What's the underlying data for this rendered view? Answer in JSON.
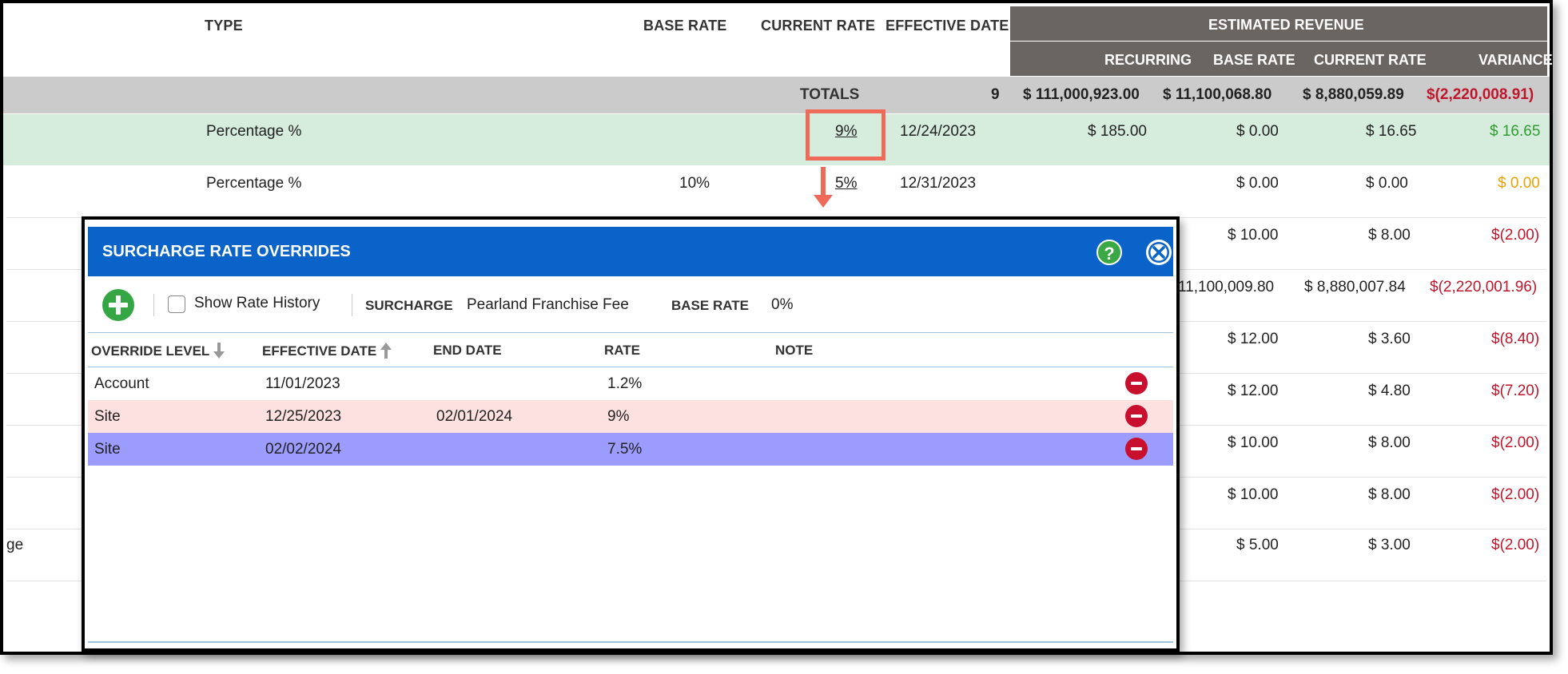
{
  "header": {
    "type": "TYPE",
    "base_rate": "BASE RATE",
    "current_rate": "CURRENT RATE",
    "effective_date": "EFFECTIVE DATE",
    "estimated_revenue": "ESTIMATED REVENUE",
    "recurring": "RECURRING",
    "rev_base_rate": "BASE RATE",
    "rev_current_rate": "CURRENT RATE",
    "variance": "VARIANCE"
  },
  "totals": {
    "label": "TOTALS",
    "count": "9",
    "recurring": "$ 111,000,923.00",
    "base_rate": "$ 11,100,068.80",
    "current_rate": "$ 8,880,059.89",
    "variance": "$(2,220,008.91)"
  },
  "rows": [
    {
      "type": "Percentage %",
      "base_rate": "",
      "current_rate": "9%",
      "effective_date": "12/24/2023",
      "recurring": "$ 185.00",
      "rev_base": "$ 0.00",
      "rev_current": "$ 16.65",
      "variance": "$ 16.65"
    },
    {
      "type": "Percentage %",
      "base_rate": "10%",
      "current_rate": "5%",
      "effective_date": "12/31/2023",
      "recurring": "",
      "rev_base": "$ 0.00",
      "rev_current": "$ 0.00",
      "variance": "$ 0.00"
    },
    {
      "rev_base": "$ 10.00",
      "rev_current": "$ 8.00",
      "variance": "$(2.00)"
    },
    {
      "rev_base": "11,100,009.80",
      "rev_current": "$ 8,880,007.84",
      "variance": "$(2,220,001.96)"
    },
    {
      "rev_base": "$ 12.00",
      "rev_current": "$ 3.60",
      "variance": "$(8.40)"
    },
    {
      "rev_base": "$ 12.00",
      "rev_current": "$ 4.80",
      "variance": "$(7.20)"
    },
    {
      "rev_base": "$ 10.00",
      "rev_current": "$ 8.00",
      "variance": "$(2.00)"
    },
    {
      "rev_base": "$ 10.00",
      "rev_current": "$ 8.00",
      "variance": "$(2.00)"
    },
    {
      "type_fragment": "ge",
      "rev_base": "$ 5.00",
      "rev_current": "$ 3.00",
      "variance": "$(2.00)"
    }
  ],
  "modal": {
    "title": "SURCHARGE RATE OVERRIDES",
    "help": "?",
    "show_history_label": "Show Rate History",
    "surcharge_label": "SURCHARGE",
    "surcharge_value": "Pearland Franchise Fee",
    "base_rate_label": "BASE RATE",
    "base_rate_value": "0%",
    "columns": {
      "override_level": "OVERRIDE LEVEL",
      "effective_date": "EFFECTIVE DATE",
      "end_date": "END DATE",
      "rate": "RATE",
      "note": "NOTE"
    },
    "rows": [
      {
        "level": "Account",
        "effective": "11/01/2023",
        "end": "",
        "rate": "1.2%",
        "note": ""
      },
      {
        "level": "Site",
        "effective": "12/25/2023",
        "end": "02/01/2024",
        "rate": "9%",
        "note": ""
      },
      {
        "level": "Site",
        "effective": "02/02/2024",
        "end": "",
        "rate": "7.5%",
        "note": ""
      }
    ]
  },
  "colors": {
    "modal_header": "#0a63c9",
    "revenue_header": "#6b6562",
    "totals_bg": "#cbcbcb",
    "highlight_row": "#d6ecdc",
    "row_pink": "#fde0e0",
    "row_selected": "#9c9cff",
    "callout": "#f06a5a",
    "negative": "#c0162b",
    "positive": "#2e9e2e",
    "neutral": "#f2a000"
  }
}
